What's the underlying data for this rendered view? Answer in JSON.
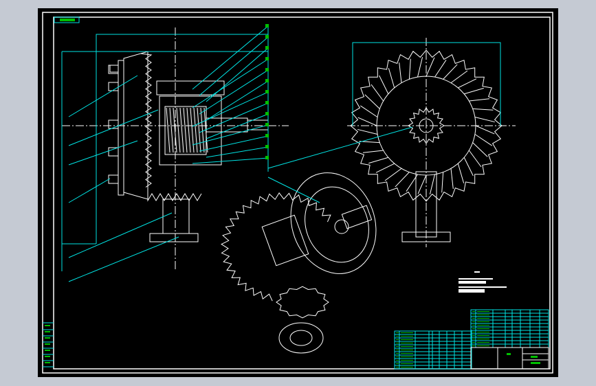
{
  "drawing": {
    "type": "cad-assembly-drawing",
    "views": [
      "side-section-view",
      "front-view",
      "isometric-view"
    ],
    "colors": {
      "viewport_background": "#c5cad3",
      "canvas": "#000000",
      "outline": "#ffffff",
      "dimension_lines": "#00e5e5",
      "text": "#00ff00"
    }
  }
}
